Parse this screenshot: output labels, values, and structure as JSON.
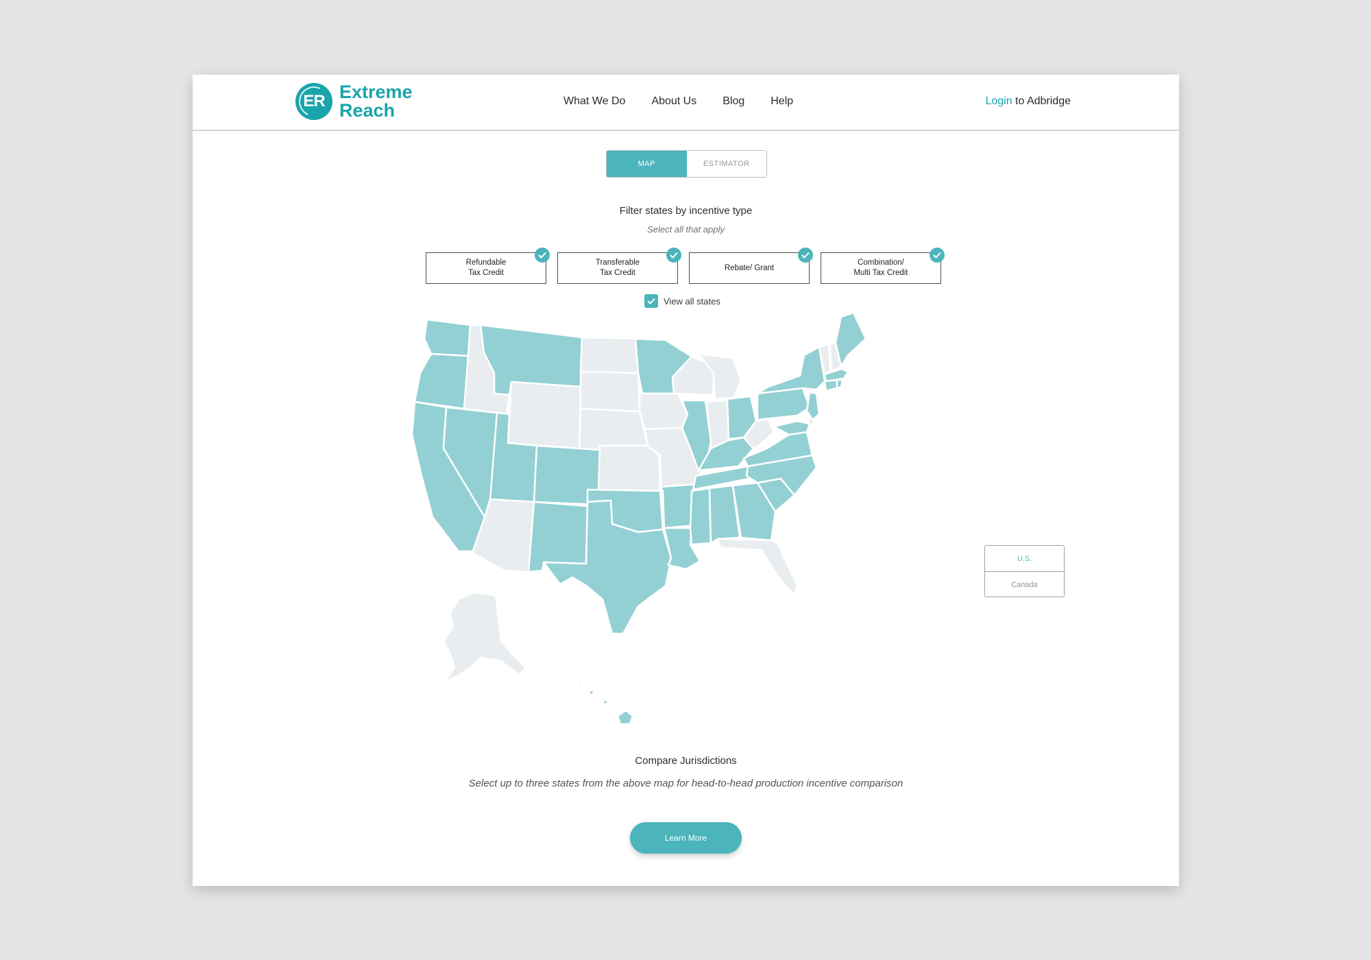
{
  "colors": {
    "accent": "#4cb4bb",
    "brand": "#1aa4ab",
    "inactive_state": "#e9edef",
    "active_state": "#93d0d3"
  },
  "brand": {
    "mark": "ER",
    "name_line1": "Extreme",
    "name_line2": "Reach"
  },
  "nav": [
    "What We Do",
    "About Us",
    "Blog",
    "Help"
  ],
  "login": {
    "link": "Login",
    "rest": " to Adbridge"
  },
  "toggle": {
    "map": "MAP",
    "estimator": "ESTIMATOR",
    "selected": "MAP"
  },
  "filter": {
    "title": "Filter states by incentive type",
    "subtitle": "Select all that apply",
    "options": [
      {
        "label": "Refundable\nTax Credit",
        "checked": true
      },
      {
        "label": "Transferable\nTax Credit",
        "checked": true
      },
      {
        "label": "Rebate/ Grant",
        "checked": true
      },
      {
        "label": "Combination/\nMulti Tax Credit",
        "checked": true
      }
    ],
    "view_all": "View all states",
    "view_all_checked": true
  },
  "country_toggle": {
    "us": "U.S.",
    "canada": "Canada",
    "selected": "U.S."
  },
  "compare": {
    "title": "Compare Jurisdictions",
    "subtitle": "Select up to three states from the above map for head-to-head production incentive comparison",
    "button": "Learn More"
  }
}
